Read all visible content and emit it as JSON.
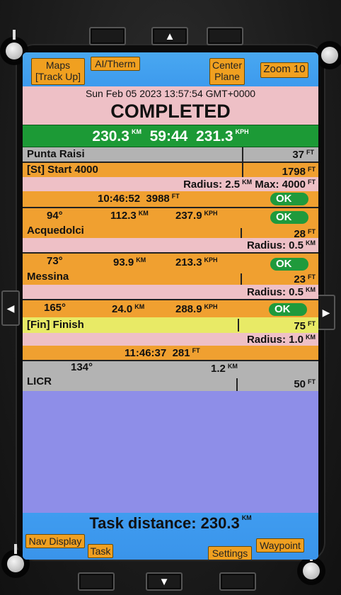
{
  "hardware": {
    "up_arrow": "▲",
    "down_arrow": "▼",
    "left_arrow": "◀",
    "right_arrow": "▶"
  },
  "top_buttons": {
    "maps": "Maps\n[Track Up]",
    "ai_therm": "AI/Therm",
    "center_plane": "Center\nPlane",
    "zoom": "Zoom 10"
  },
  "status": {
    "datetime": "Sun Feb 05 2023 13:57:54 GMT+0000",
    "state": "COMPLETED"
  },
  "summary": {
    "distance": "230.3",
    "distance_unit": "KM",
    "time": "59:44",
    "speed": "231.3",
    "speed_unit": "KPH"
  },
  "departure": {
    "name": "Punta Raisi",
    "elevation": "37",
    "elevation_unit": "FT"
  },
  "start": {
    "name": "[St] Start 4000",
    "elevation": "1798",
    "elevation_unit": "FT",
    "radius_label": "Radius: 2.5",
    "radius_unit": "KM",
    "max_label": "Max: 4000",
    "max_unit": "FT",
    "time": "10:46:52",
    "alt": "3988",
    "alt_unit": "FT",
    "ok": "OK"
  },
  "legs": [
    {
      "bearing": "94°",
      "distance": "112.3",
      "distance_unit": "KM",
      "speed": "237.9",
      "speed_unit": "KPH",
      "ok": "OK",
      "name": "Acquedolci",
      "elevation": "28",
      "elevation_unit": "FT",
      "radius": "Radius: 0.5",
      "radius_unit": "KM"
    },
    {
      "bearing": "73°",
      "distance": "93.9",
      "distance_unit": "KM",
      "speed": "213.3",
      "speed_unit": "KPH",
      "ok": "OK",
      "name": "Messina",
      "elevation": "23",
      "elevation_unit": "FT",
      "radius": "Radius: 0.5",
      "radius_unit": "KM"
    },
    {
      "bearing": "165°",
      "distance": "24.0",
      "distance_unit": "KM",
      "speed": "288.9",
      "speed_unit": "KPH",
      "ok": "OK",
      "name": "[Fin] Finish",
      "elevation": "75",
      "elevation_unit": "FT",
      "radius": "Radius: 1.0",
      "radius_unit": "KM"
    }
  ],
  "finish_time": {
    "time": "11:46:37",
    "alt": "281",
    "alt_unit": "FT"
  },
  "destination": {
    "bearing": "134°",
    "distance": "1.2",
    "distance_unit": "KM",
    "name": "LICR",
    "elevation": "50",
    "elevation_unit": "FT"
  },
  "footer": {
    "task_distance_label": "Task distance: 230.3",
    "task_distance_unit": "KM"
  },
  "bottom_buttons": {
    "nav_display": "Nav Display",
    "task": "Task",
    "settings": "Settings",
    "waypoint": "Waypoint"
  },
  "colors": {
    "orange": "#f0a030",
    "pink": "#eec0c6",
    "green": "#1c9a36",
    "gray": "#b3b3b3",
    "yellow": "#e8ea66",
    "lavender": "#8e8ee8",
    "blue": "#3d9aee"
  }
}
